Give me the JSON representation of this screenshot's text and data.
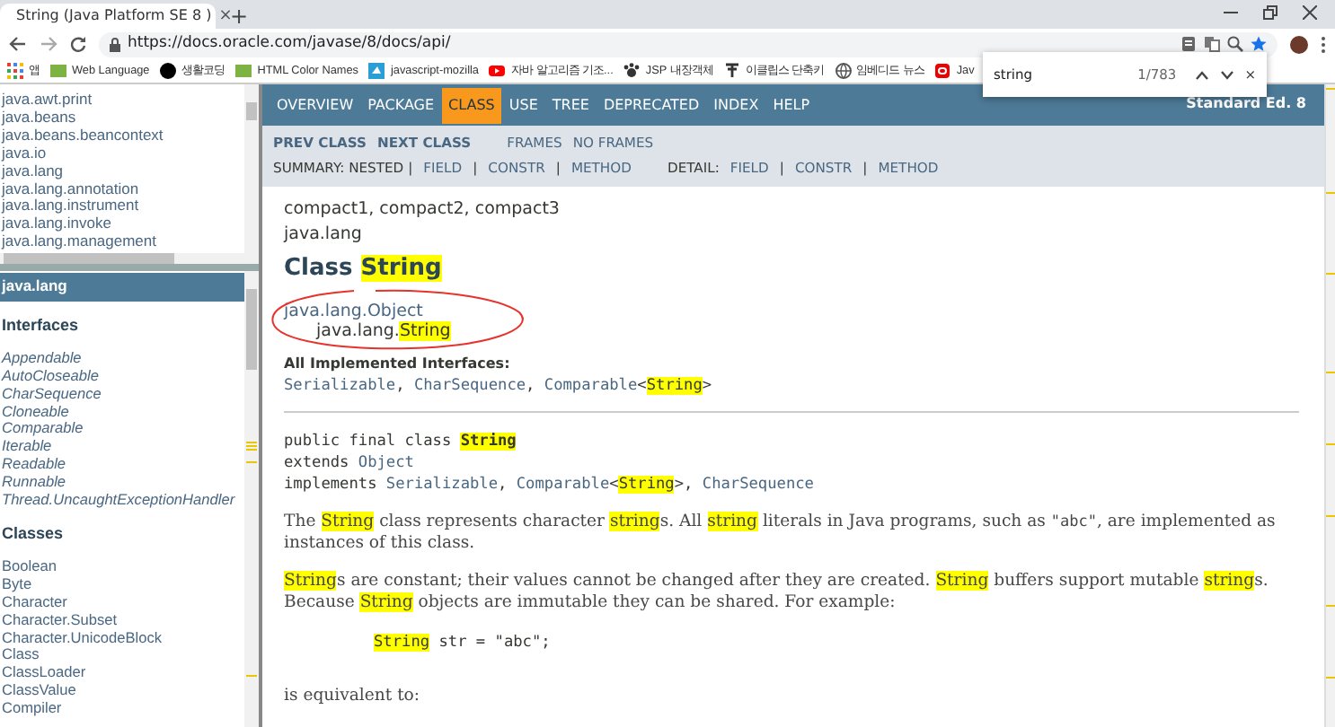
{
  "browser": {
    "tab": {
      "title": "String (Java Platform SE 8 )",
      "close": "×"
    },
    "new_tab": "+",
    "url": "https://docs.oracle.com/javase/8/docs/api/",
    "bookmarks": [
      {
        "label": "앱"
      },
      {
        "label": "Web Language"
      },
      {
        "label": "생활코딩"
      },
      {
        "label": "HTML Color Names"
      },
      {
        "label": "javascript-mozilla"
      },
      {
        "label": "자바 알고리즘 기조..."
      },
      {
        "label": "JSP 내장객체"
      },
      {
        "label": "이클립스 단축키"
      },
      {
        "label": "임베디드 뉴스"
      },
      {
        "label": "Jav"
      }
    ],
    "find_bar": {
      "query": "string",
      "count": "1/783",
      "close": "×"
    }
  },
  "packages": [
    "java.awt.print",
    "java.beans",
    "java.beans.beancontext",
    "java.io",
    "java.lang",
    "java.lang.annotation",
    "java.lang.instrument",
    "java.lang.invoke",
    "java.lang.management"
  ],
  "package_frame": {
    "title": "java.lang",
    "sections": [
      {
        "heading": "Interfaces",
        "italic": true,
        "items": [
          "Appendable",
          "AutoCloseable",
          "CharSequence",
          "Cloneable",
          "Comparable",
          "Iterable",
          "Readable",
          "Runnable",
          "Thread.UncaughtExceptionHandler"
        ]
      },
      {
        "heading": "Classes",
        "italic": false,
        "items": [
          "Boolean",
          "Byte",
          "Character",
          "Character.Subset",
          "Character.UnicodeBlock",
          "Class",
          "ClassLoader",
          "ClassValue",
          "Compiler"
        ]
      }
    ]
  },
  "nav": {
    "tabs": [
      {
        "label": "OVERVIEW",
        "selected": false
      },
      {
        "label": "PACKAGE",
        "selected": false
      },
      {
        "label": "CLASS",
        "selected": true
      },
      {
        "label": "USE",
        "selected": false
      },
      {
        "label": "TREE",
        "selected": false
      },
      {
        "label": "DEPRECATED",
        "selected": false
      },
      {
        "label": "INDEX",
        "selected": false
      },
      {
        "label": "HELP",
        "selected": false
      }
    ],
    "about": "Standard Ed. 8"
  },
  "subnav": {
    "row_1": [
      {
        "text": "PREV CLASS",
        "kind": "strong"
      },
      {
        "text": "NEXT CLASS",
        "kind": "strong"
      },
      {
        "text": "FRAMES",
        "kind": "link"
      },
      {
        "text": "NO FRAMES",
        "kind": "link"
      }
    ],
    "row_2": [
      {
        "text": "SUMMARY: NESTED |",
        "kind": "text"
      },
      {
        "text": "FIELD",
        "kind": "link"
      },
      {
        "text": "|",
        "kind": "text"
      },
      {
        "text": "CONSTR",
        "kind": "link"
      },
      {
        "text": "|",
        "kind": "text"
      },
      {
        "text": "METHOD",
        "kind": "link"
      },
      {
        "text": "DETAIL:",
        "kind": "text"
      },
      {
        "text": "FIELD",
        "kind": "link"
      },
      {
        "text": "|",
        "kind": "text"
      },
      {
        "text": "CONSTR",
        "kind": "link"
      },
      {
        "text": "|",
        "kind": "text"
      },
      {
        "text": "METHOD",
        "kind": "link"
      }
    ]
  },
  "content": [
    {
      "kind": "sub",
      "parts": [
        {
          "text": "compact1, compact2, compact3",
          "kind": "plain"
        }
      ]
    },
    {
      "kind": "sub",
      "parts": [
        {
          "text": "java.lang",
          "kind": "plain"
        }
      ]
    },
    {
      "kind": "heading",
      "parts": [
        {
          "text": "Class ",
          "kind": "plain"
        },
        {
          "text": "String",
          "kind": "match"
        }
      ]
    },
    {
      "kind": "tree",
      "parts": [
        {
          "text": "java.lang.Object",
          "kind": "link"
        }
      ]
    },
    {
      "kind": "tree-child",
      "parts": [
        {
          "text": "java.lang.",
          "kind": "plain"
        },
        {
          "text": "String",
          "kind": "match"
        }
      ]
    },
    {
      "kind": "label",
      "parts": [
        {
          "text": "All Implemented Interfaces:",
          "kind": "plain"
        }
      ]
    },
    {
      "kind": "code",
      "parts": [
        {
          "text": "Serializable",
          "kind": "link"
        },
        {
          "text": ", ",
          "kind": "plain"
        },
        {
          "text": "CharSequence",
          "kind": "link"
        },
        {
          "text": ", ",
          "kind": "plain"
        },
        {
          "text": "Comparable",
          "kind": "link"
        },
        {
          "text": "<",
          "kind": "plain"
        },
        {
          "text": "String",
          "kind": "match"
        },
        {
          "text": ">",
          "kind": "plain"
        }
      ]
    },
    {
      "kind": "rule"
    },
    {
      "kind": "code-first",
      "parts": [
        {
          "text": "public final class ",
          "kind": "plain"
        },
        {
          "text": "String",
          "kind": "match-bold"
        }
      ]
    },
    {
      "kind": "code",
      "parts": [
        {
          "text": "extends ",
          "kind": "plain"
        },
        {
          "text": "Object",
          "kind": "link"
        }
      ]
    },
    {
      "kind": "code",
      "parts": [
        {
          "text": "implements ",
          "kind": "plain"
        },
        {
          "text": "Serializable",
          "kind": "link"
        },
        {
          "text": ", ",
          "kind": "plain"
        },
        {
          "text": "Comparable",
          "kind": "link"
        },
        {
          "text": "<",
          "kind": "plain"
        },
        {
          "text": "String",
          "kind": "match"
        },
        {
          "text": ">, ",
          "kind": "plain"
        },
        {
          "text": "CharSequence",
          "kind": "link"
        }
      ]
    },
    {
      "kind": "para",
      "parts": [
        {
          "text": "The ",
          "kind": "plain"
        },
        {
          "text": "String",
          "kind": "match"
        },
        {
          "text": " class represents character ",
          "kind": "plain"
        },
        {
          "text": "string",
          "kind": "match"
        },
        {
          "text": "s. All ",
          "kind": "plain"
        },
        {
          "text": "string",
          "kind": "match"
        },
        {
          "text": " literals in Java programs, such as ",
          "kind": "plain"
        },
        {
          "text": "\"abc\"",
          "kind": "mono"
        },
        {
          "text": ", are implemented as instances of this class.",
          "kind": "plain"
        }
      ]
    },
    {
      "kind": "para",
      "parts": [
        {
          "text": "String",
          "kind": "match"
        },
        {
          "text": "s are constant; their values cannot be changed after they are created. ",
          "kind": "plain"
        },
        {
          "text": "String",
          "kind": "match"
        },
        {
          "text": " buffers support mutable ",
          "kind": "plain"
        },
        {
          "text": "string",
          "kind": "match"
        },
        {
          "text": "s. Because ",
          "kind": "plain"
        },
        {
          "text": "String",
          "kind": "match"
        },
        {
          "text": " objects are immutable they can be shared. For example:",
          "kind": "plain"
        }
      ]
    },
    {
      "kind": "example",
      "parts": [
        {
          "text": "String",
          "kind": "match"
        },
        {
          "text": " str = \"abc\";",
          "kind": "plain"
        }
      ]
    },
    {
      "kind": "para",
      "parts": [
        {
          "text": "is equivalent to:",
          "kind": "plain"
        }
      ]
    }
  ]
}
